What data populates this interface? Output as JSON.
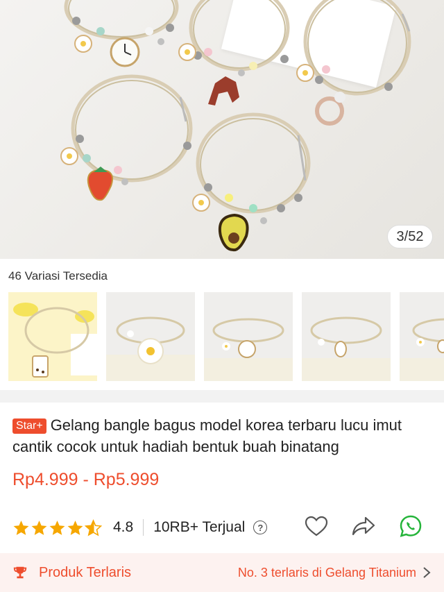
{
  "gallery": {
    "counter": "3/52"
  },
  "variations": {
    "title": "46 Variasi Tersedia",
    "thumbnails": [
      "boba-charm",
      "daisy-charm",
      "clock-charm",
      "rabbit-charm",
      "flower-charm"
    ]
  },
  "product": {
    "badge": "Star+",
    "title": "Gelang bangle bagus model korea terbaru lucu imut cantik cocok untuk hadiah bentuk buah binatang",
    "price": "Rp4.999 - Rp5.999",
    "rating": "4.8",
    "stars": 4.5,
    "sold": "10RB+ Terjual",
    "help_symbol": "?"
  },
  "actions": [
    "heart-icon",
    "share-icon",
    "whatsapp-icon"
  ],
  "bestseller": {
    "label": "Produk Terlaris",
    "rank_text": "No. 3 terlaris di Gelang Titanium"
  },
  "colors": {
    "accent": "#ee4d2d",
    "star": "#f6a700",
    "whatsapp": "#25b43a",
    "bestseller_bg": "#fdf2f0"
  }
}
